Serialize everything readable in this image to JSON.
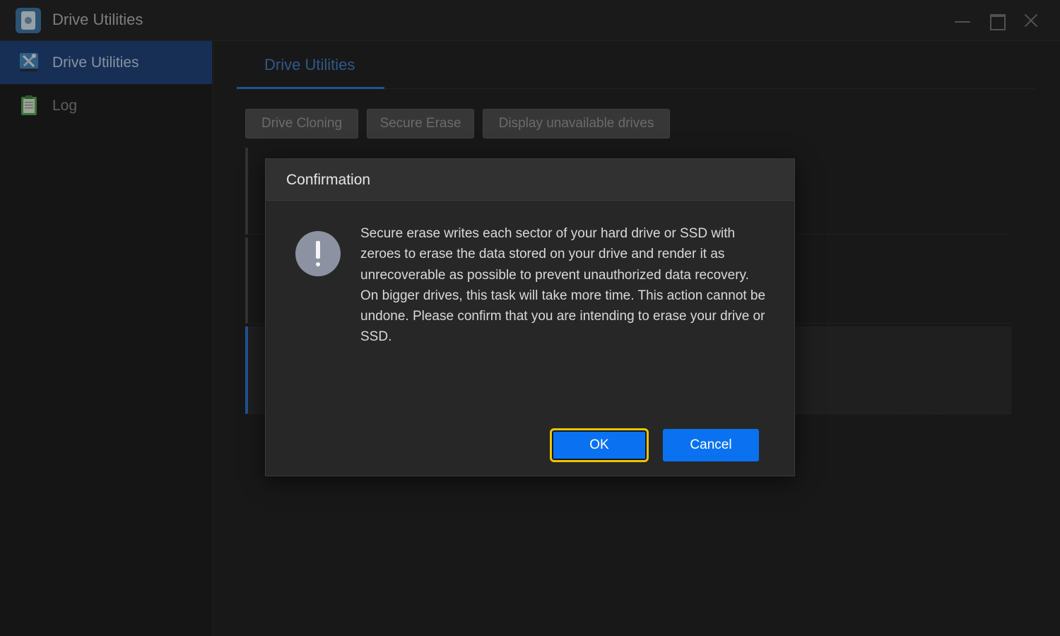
{
  "window": {
    "title": "Drive Utilities",
    "icons": [
      "drive-utilities-app-icon",
      "minimize-icon",
      "maximize-icon",
      "close-icon"
    ]
  },
  "sidebar": {
    "items": [
      {
        "label": "Drive Utilities",
        "icon": "tools-icon",
        "active": true
      },
      {
        "label": "Log",
        "icon": "clipboard-icon",
        "active": false
      }
    ]
  },
  "main": {
    "tabs": [
      {
        "label": "Drive Utilities",
        "active": true
      }
    ],
    "toolbar": {
      "drive_cloning_label": "Drive Cloning",
      "secure_erase_label": "Secure Erase",
      "display_unavailable_label": "Display unavailable drives"
    }
  },
  "dialog": {
    "title": "Confirmation",
    "icon": "warning-icon",
    "message": "Secure erase writes each sector of your hard drive or SSD with zeroes to erase the data stored on your drive and render it as unrecoverable as possible to prevent unauthorized data recovery. On bigger drives, this task will take more time. This action cannot be undone. Please confirm that you are intending to erase your drive or SSD.",
    "ok_label": "OK",
    "cancel_label": "Cancel"
  },
  "colors": {
    "accent": "#0a72f0",
    "sidebar_active": "#1f3f72",
    "focus_ring": "#f2c300"
  }
}
